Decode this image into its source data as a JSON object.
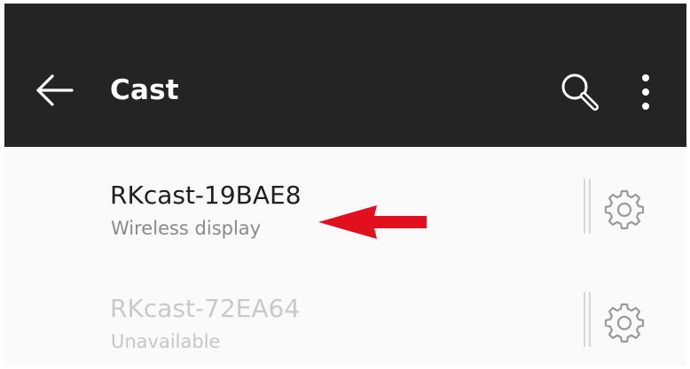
{
  "toolbar": {
    "title": "Cast",
    "back_icon": "arrow-left-icon",
    "search_icon": "search-icon",
    "more_icon": "more-vert-icon",
    "background": "#242424"
  },
  "devices": [
    {
      "name": "RKcast-19BAE8",
      "status": "Wireless display",
      "available": true
    },
    {
      "name": "RKcast-72EA64",
      "status": "Unavailable",
      "available": false
    }
  ],
  "annotation": {
    "type": "arrow",
    "color": "#e0101f",
    "points_to": "RKcast-19BAE8"
  }
}
